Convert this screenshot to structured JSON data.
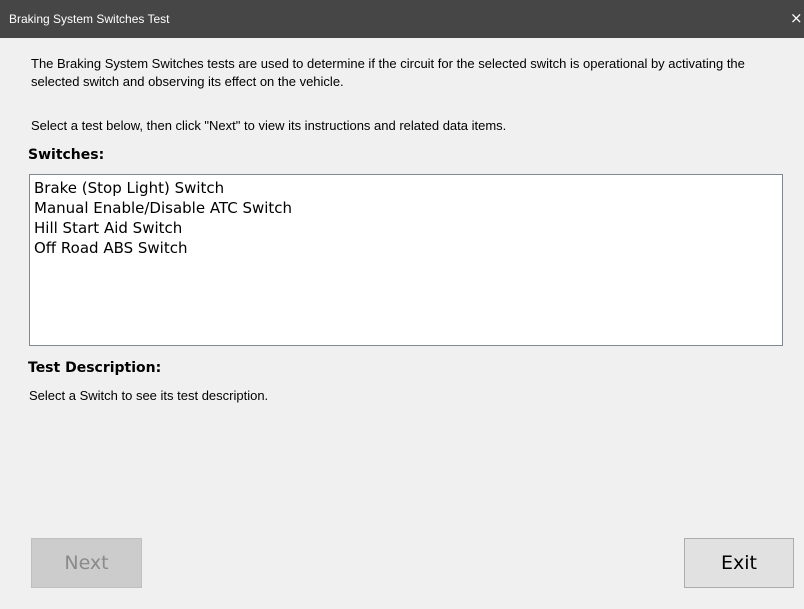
{
  "window": {
    "title": "Braking System Switches Test",
    "close_glyph": "×"
  },
  "intro": {
    "description": "The Braking System Switches tests are used to determine if the circuit for the selected switch is operational by activating the selected switch and observing its effect on the vehicle.",
    "instruction": "Select a test below, then click \"Next\" to view its instructions and related data items."
  },
  "switches": {
    "heading": "Switches:",
    "items": [
      "Brake (Stop Light) Switch",
      "Manual Enable/Disable ATC Switch",
      "Hill Start Aid Switch",
      "Off Road ABS Switch"
    ]
  },
  "test_description": {
    "heading": "Test Description:",
    "text": "Select a Switch to see its test description."
  },
  "buttons": {
    "next_label": "Next",
    "next_enabled": false,
    "exit_label": "Exit"
  },
  "colors": {
    "titlebar": "#464646",
    "background": "#f0f0f0",
    "disabled_button": "#cccccc",
    "button": "#e1e1e1"
  }
}
